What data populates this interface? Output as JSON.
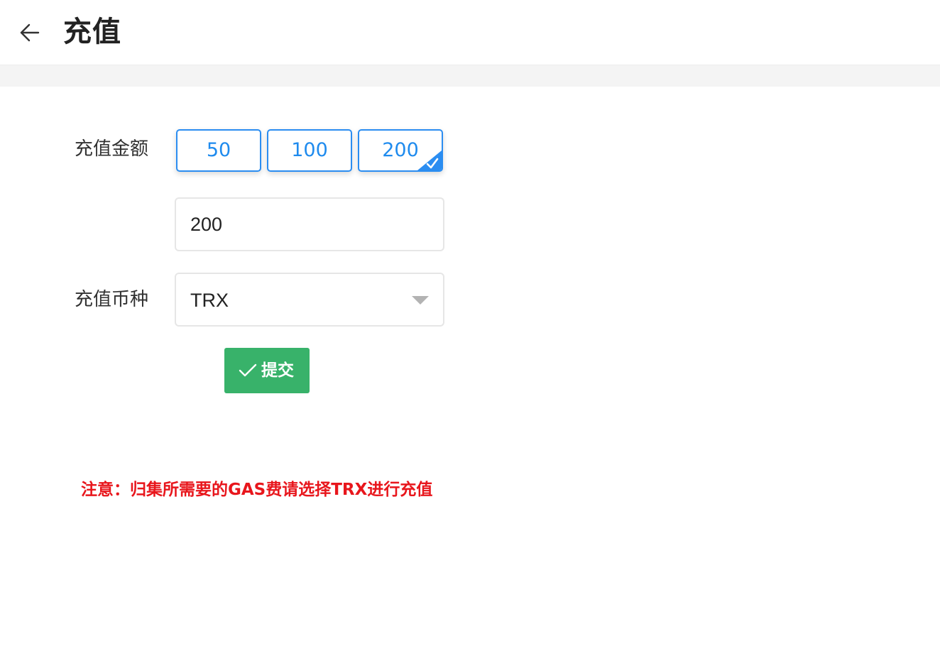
{
  "header": {
    "title": "充值",
    "back_icon": "arrow-left-icon"
  },
  "form": {
    "amount_label": "充值金额",
    "amount_options": [
      "50",
      "100",
      "200"
    ],
    "selected_amount": "200",
    "amount_input_value": "200",
    "currency_label": "充值币种",
    "currency_value": "TRX",
    "submit_label": "提交"
  },
  "notice": "注意：归集所需要的GAS费请选择TRX进行充值",
  "colors": {
    "accent_blue": "#2b8df1",
    "submit_green": "#38b26a",
    "notice_red": "#e8161c"
  }
}
